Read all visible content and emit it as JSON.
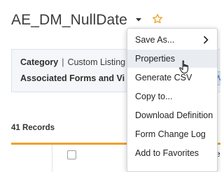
{
  "header": {
    "title": "AE_DM_NullDate"
  },
  "info": {
    "category_label": "Category",
    "category_value": "Custom Listing",
    "associated_label": "Associated Forms and Vi",
    "peek_text": "W"
  },
  "records": {
    "count_label": "41 Records"
  },
  "table": {
    "header_peek": "e"
  },
  "menu": {
    "items": [
      {
        "label": "Save As..."
      },
      {
        "label": "Properties"
      },
      {
        "label": "Generate CSV"
      },
      {
        "label": "Copy to..."
      },
      {
        "label": "Download Definition"
      },
      {
        "label": "Form Change Log"
      },
      {
        "label": "Add to Favorites"
      }
    ]
  },
  "icons": {
    "caret": "caret-down-icon",
    "star": "star-outline-icon",
    "submenu": "chevron-right-icon",
    "cursor": "hand-pointer-icon"
  },
  "colors": {
    "star": "#f0a02a",
    "table_accent": "#f0a02a",
    "menu_hover": "#e9edf2",
    "info_panel_bg": "#f4f6f9"
  }
}
